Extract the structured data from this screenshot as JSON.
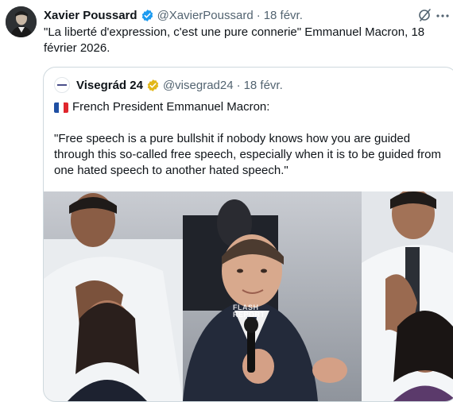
{
  "tweet": {
    "author_name": "Xavier Poussard",
    "author_handle": "@XavierPoussard",
    "separator": "·",
    "time": "18 févr.",
    "text": "\"La liberté d'expression, c'est une pure connerie\" Emmanuel Macron, 18 février 2026.",
    "verified_color": "#1d9bf0"
  },
  "quote": {
    "author_name": "Visegrád 24",
    "author_handle": "@visegrad24",
    "separator": "·",
    "time": "18 févr.",
    "verified_color": "#e2b719",
    "line1": "French President Emmanuel Macron:",
    "body": "\"Free speech is a pure bullshit if nobody knows how you are guided through this so-called free speech, especially when it is to be guided from one hated speech to another hated speech.\"",
    "media": {
      "watermark_line1": "FLASH",
      "watermark_line2": "REPORT"
    }
  },
  "icons": {
    "grok": "slash-circle-icon",
    "more": "more-icon"
  }
}
